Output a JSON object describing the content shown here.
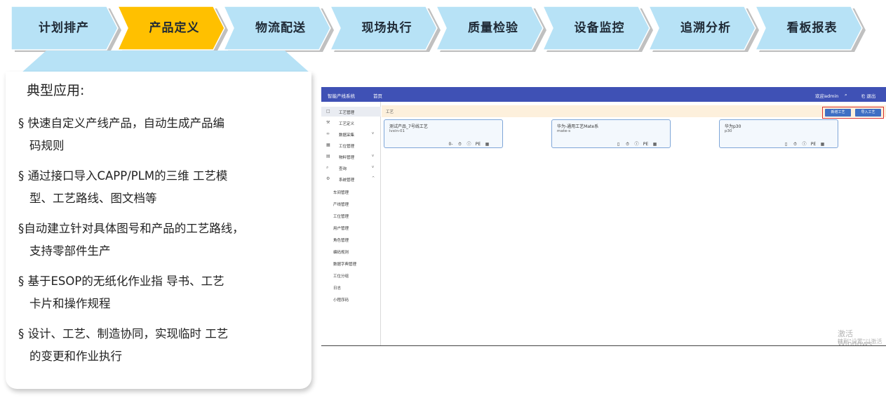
{
  "steps": [
    {
      "label": "计划排产",
      "active": false
    },
    {
      "label": "产品定义",
      "active": true
    },
    {
      "label": "物流配送",
      "active": false
    },
    {
      "label": "现场执行",
      "active": false
    },
    {
      "label": "质量检验",
      "active": false
    },
    {
      "label": "设备监控",
      "active": false
    },
    {
      "label": "追溯分析",
      "active": false
    },
    {
      "label": "看板报表",
      "active": false
    }
  ],
  "colors": {
    "step_fill": "#b7e2f6",
    "step_active_fill": "#ffc000",
    "step_shadow": "#8c8c8c",
    "app_header": "#3f51b5",
    "highlight_border": "#d9302c"
  },
  "card": {
    "title": "典型应用:",
    "bullets": [
      {
        "line1": "§  快速自定义产线产品，自动生成产品编",
        "line2": "码规则"
      },
      {
        "line1": "§ 通过接口导入CAPP/PLM的三维 工艺模",
        "line2": "型、工艺路线、图文档等"
      },
      {
        "line1": "§自动建立针对具体图号和产品的工艺路线，",
        "line2": "支持零部件生产"
      },
      {
        "line1": "§ 基于ESOP的无纸化作业指 导书、工艺",
        "line2": "卡片和操作规程"
      },
      {
        "line1": "§ 设计、工艺、制造协同，实现临时 工艺",
        "line2": "的变更和作业执行"
      }
    ]
  },
  "app": {
    "header": {
      "title": "智能产线系统",
      "nav": "首页",
      "user": "欢迎admin",
      "search_icon": "search-icon",
      "exit": "退出"
    },
    "sidebar": {
      "items": [
        {
          "icon": "book-icon",
          "label": "工艺管理",
          "chevron": "",
          "active": true
        },
        {
          "icon": "wrench-icon",
          "label": "工艺定义",
          "chevron": "",
          "active": false
        },
        {
          "icon": "link-icon",
          "label": "数据采集",
          "chevron": "v",
          "active": false
        },
        {
          "icon": "grid-icon",
          "label": "工位管理",
          "chevron": "",
          "active": false
        },
        {
          "icon": "table-icon",
          "label": "物料管理",
          "chevron": "v",
          "active": false
        },
        {
          "icon": "search-icon",
          "label": "查询",
          "chevron": "v",
          "active": false
        },
        {
          "icon": "gear-icon",
          "label": "系统管理",
          "chevron": "^",
          "active": false
        }
      ],
      "sub_items": [
        "车间管理",
        "产线管理",
        "工位管理",
        "用户管理",
        "角色管理",
        "编码规则",
        "数据字典管理",
        "工位分组",
        "日志",
        "小程序码"
      ]
    },
    "breadcrumb": "工艺",
    "buttons": {
      "add": "新增工艺",
      "import": "导入工艺"
    },
    "products": [
      {
        "title": "测试产品_7号线工艺",
        "code": "lvxin-01",
        "actions": [
          "0-",
          "⏱",
          "ⓘ",
          "PE",
          "▦"
        ]
      },
      {
        "title": "华为-通用工艺Mate系",
        "code": "mate-s",
        "actions": [
          "▯",
          "⏱",
          "ⓘ",
          "PE",
          "▦"
        ]
      },
      {
        "title": "华为p30",
        "code": "p30",
        "actions": [
          "▯",
          "⏱",
          "ⓘ",
          "PE",
          "▦"
        ]
      }
    ],
    "watermark": {
      "line1": "激活 Windows",
      "line2": "转到\"设置\"以激活 Windows。"
    }
  }
}
